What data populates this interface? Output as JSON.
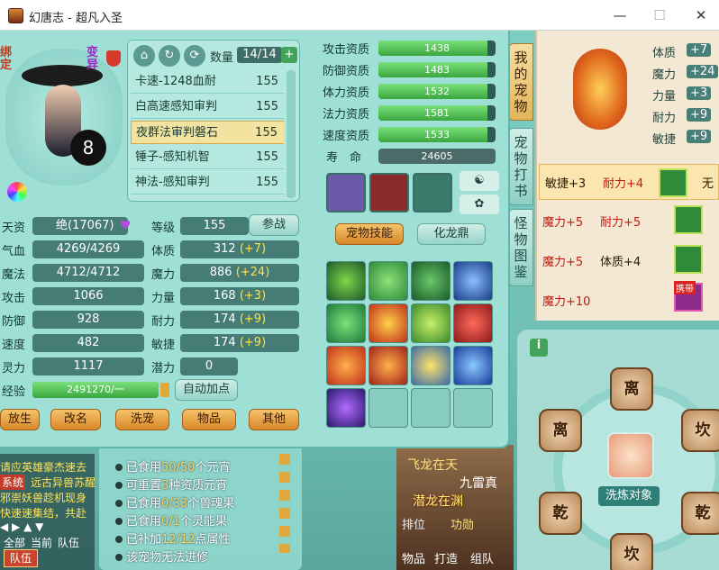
{
  "window": {
    "title": "幻唐志 - 超凡入圣",
    "minimize": "—",
    "maximize": "☐",
    "close": "✕"
  },
  "pet": {
    "badge_left": "绑定",
    "badge_right": "变异",
    "count_label": "数量",
    "count_value": "14/14",
    "list": [
      {
        "name": "卡速-1248血耐",
        "level": "155"
      },
      {
        "name": "白高速感知审判",
        "level": "155"
      },
      {
        "name": "夜群法审判磐石",
        "level": "155"
      },
      {
        "name": "锤子-感知机智",
        "level": "155"
      },
      {
        "name": "神法-感知审判",
        "level": "155"
      }
    ],
    "selected_index": 2
  },
  "aptitude": {
    "labels": [
      "攻击资质",
      "防御资质",
      "体力资质",
      "法力资质",
      "速度资质"
    ],
    "values": [
      "1438",
      "1483",
      "1532",
      "1581",
      "1533"
    ],
    "fill": [
      0.93,
      0.93,
      0.93,
      0.93,
      0.93
    ],
    "life_label": "寿　命",
    "life_value": "24605"
  },
  "attrs": {
    "tianzi_label": "天资",
    "tianzi_value": "绝(17067)",
    "level_label": "等级",
    "level_value": "155",
    "fight_btn": "参战",
    "hp_label": "气血",
    "hp_value": "4269/4269",
    "mp_label": "魔法",
    "mp_value": "4712/4712",
    "atk_label": "攻击",
    "atk_value": "1066",
    "def_label": "防御",
    "def_value": "928",
    "spd_label": "速度",
    "spd_value": "482",
    "spi_label": "灵力",
    "spi_value": "1117",
    "tizhi_label": "体质",
    "tizhi_value": "312",
    "tizhi_bonus": "(+7)",
    "moli_label": "魔力",
    "moli_value": "886",
    "moli_bonus": "(+24)",
    "liliang_label": "力量",
    "liliang_value": "168",
    "liliang_bonus": "(+3)",
    "naili_label": "耐力",
    "naili_value": "174",
    "naili_bonus": "(+9)",
    "minjie_label": "敏捷",
    "minjie_value": "174",
    "minjie_bonus": "(+9)",
    "qianli_label": "潜力",
    "qianli_value": "0",
    "exp_label": "经验",
    "exp_value": "2491270/一",
    "auto_btn": "自动加点"
  },
  "bottom_buttons": [
    "放生",
    "改名",
    "洗宠",
    "物品",
    "其他"
  ],
  "skills": {
    "tab_skill": "宠物技能",
    "tab_dragon": "化龙鼎"
  },
  "side_tabs": [
    "我的宠物",
    "宠物打书",
    "怪物图鉴"
  ],
  "right_panel": {
    "bonuses": [
      {
        "label": "体质",
        "value": "+7"
      },
      {
        "label": "魔力",
        "value": "+24"
      },
      {
        "label": "力量",
        "value": "+3"
      },
      {
        "label": "耐力",
        "value": "+9"
      },
      {
        "label": "敏捷",
        "value": "+9"
      }
    ],
    "rows": [
      {
        "a": "敏捷+3",
        "b": "耐力+4",
        "c": "无"
      },
      {
        "a": "魔力+5",
        "b": "耐力+5",
        "c": ""
      },
      {
        "a": "魔力+5",
        "b": "体质+4",
        "c": ""
      },
      {
        "a": "魔力+10",
        "b": "",
        "c": ""
      }
    ],
    "carry_tag": "携带"
  },
  "bagua": {
    "top": "离",
    "left": "离",
    "right": "坎",
    "bottom_left": "乾",
    "bottom_right": "乾",
    "bottom": "坎",
    "center_btn": "洗炼对象"
  },
  "notes": [
    {
      "pre": "已食用",
      "hl": "50/50",
      "post": "个元宵"
    },
    {
      "pre": "可重置",
      "hl": "3",
      "post": "种资质元宵"
    },
    {
      "pre": "已食用",
      "hl": "0/33",
      "post": "个兽魂果"
    },
    {
      "pre": "已食用",
      "hl": "0/1",
      "post": "个灵能果"
    },
    {
      "pre": "已补加",
      "hl": "12/12",
      "post": "点属性"
    },
    {
      "pre": "该宠物无法进修",
      "hl": "",
      "post": ""
    }
  ],
  "chat": {
    "lines": [
      "请应英雄豪杰速去",
      "远古异兽苏醒",
      "邪崇妖兽趁机现身",
      "快速速集结，共赴"
    ],
    "system_tag": "系统",
    "tabs": [
      "全部",
      "当前",
      "队伍"
    ],
    "team_btn": "队伍"
  },
  "bg_text": [
    "飞龙在天",
    "潜龙在渊",
    "九雷真",
    "排位",
    "功勋",
    "打造",
    "组队",
    "物品"
  ],
  "colors": {
    "panel": "#9fe0d6",
    "field": "#467c76",
    "orange": "#e19a3c",
    "selected": "#f2e3a0"
  }
}
